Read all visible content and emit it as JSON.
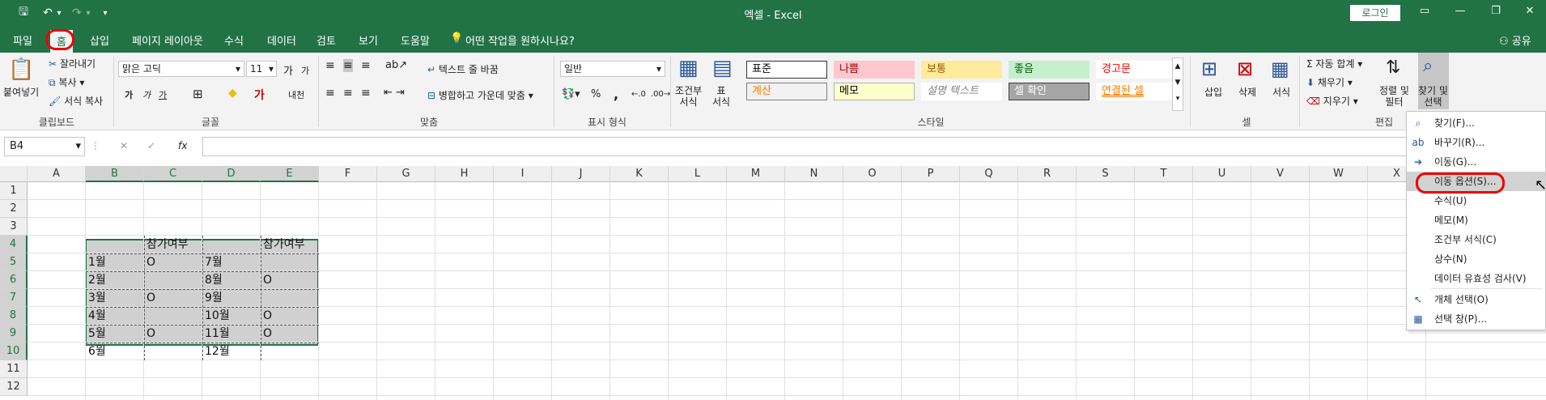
{
  "titlebar": {
    "title": "엑셀  -  Excel",
    "login": "로그인",
    "qa": {
      "save": "🖫",
      "undo": "↶",
      "undo_more": "▾",
      "redo": "↷",
      "redo_more": "▾",
      "customize": "▾"
    },
    "winctl": {
      "ribbon_opt": "▭",
      "minimize": "—",
      "restore": "❐",
      "close": "✕"
    }
  },
  "tabs": [
    "파일",
    "홈",
    "삽입",
    "페이지 레이아웃",
    "수식",
    "데이터",
    "검토",
    "보기",
    "도움말"
  ],
  "tell_me": "어떤 작업을 원하시나요?",
  "share": "공유",
  "ribbon": {
    "clipboard": {
      "paste": "붙여넣기",
      "cut": "잘라내기",
      "copy": "복사",
      "format_painter": "서식 복사",
      "group": "클립보드"
    },
    "font": {
      "font_name": "맑은 고딕",
      "font_size": "11",
      "bold": "가",
      "italic": "가",
      "underline": "가",
      "grow": "가",
      "shrink": "가",
      "group": "글꼴",
      "phonetic": "내천"
    },
    "alignment": {
      "wrap": "텍스트 줄 바꿈",
      "merge": "병합하고 가운데 맞춤",
      "group": "맞춤"
    },
    "number": {
      "format": "일반",
      "percent": "%",
      "comma": ",",
      "group": "표시 형식"
    },
    "styles": {
      "conditional": "조건부\n서식",
      "table": "표\n서식",
      "cells": [
        {
          "label": "표준",
          "bg": "#ffffff",
          "fg": "#000000",
          "border": "#333333"
        },
        {
          "label": "나쁨",
          "bg": "#ffc7ce",
          "fg": "#9c0006",
          "border": "#ffc7ce"
        },
        {
          "label": "보통",
          "bg": "#ffeb9c",
          "fg": "#9c5700",
          "border": "#ffeb9c"
        },
        {
          "label": "좋음",
          "bg": "#c6efce",
          "fg": "#006100",
          "border": "#c6efce"
        },
        {
          "label": "경고문",
          "bg": "#ffffff",
          "fg": "#ff0000",
          "border": "#ffffff"
        },
        {
          "label": "계산",
          "bg": "#f2f2f2",
          "fg": "#fa7d00",
          "border": "#7f7f7f"
        },
        {
          "label": "메모",
          "bg": "#ffffcc",
          "fg": "#000000",
          "border": "#b2b2b2"
        },
        {
          "label": "설명 텍스트",
          "bg": "#ffffff",
          "fg": "#7f7f7f",
          "border": "#ffffff"
        },
        {
          "label": "셀 확인",
          "bg": "#a5a5a5",
          "fg": "#ffffff",
          "border": "#3f3f3f"
        },
        {
          "label": "연결된 셀",
          "bg": "#ffffff",
          "fg": "#fa7d00",
          "border": "#ffffff"
        }
      ],
      "group": "스타일"
    },
    "cells": {
      "insert": "삽입",
      "delete": "삭제",
      "format": "서식",
      "group": "셀"
    },
    "editing": {
      "autosum": "자동 합계",
      "fill": "채우기",
      "clear": "지우기",
      "sort": "정렬 및\n필터",
      "find": "찾기 및\n선택",
      "group": "편집"
    }
  },
  "formula_bar": {
    "name_box": "B4",
    "fx": "fx",
    "cancel": "✕",
    "enter": "✓",
    "value": ""
  },
  "grid": {
    "columns": [
      "A",
      "B",
      "C",
      "D",
      "E",
      "F",
      "G",
      "H",
      "I",
      "J",
      "K",
      "L",
      "M",
      "N",
      "O",
      "P",
      "Q",
      "R",
      "S",
      "T",
      "U",
      "V",
      "W",
      "X"
    ],
    "selected_columns": [
      "B",
      "C",
      "D",
      "E"
    ],
    "rows": [
      "1",
      "2",
      "3",
      "4",
      "5",
      "6",
      "7",
      "8",
      "9",
      "10",
      "11",
      "12"
    ],
    "selected_rows": [
      "4",
      "5",
      "6",
      "7",
      "8",
      "9",
      "10"
    ],
    "cells": [
      {
        "col": "C",
        "row": "4",
        "value": "참가여부"
      },
      {
        "col": "E",
        "row": "4",
        "value": "참가여부"
      },
      {
        "col": "B",
        "row": "5",
        "value": "1월"
      },
      {
        "col": "C",
        "row": "5",
        "value": "O"
      },
      {
        "col": "D",
        "row": "5",
        "value": "7월"
      },
      {
        "col": "B",
        "row": "6",
        "value": "2월"
      },
      {
        "col": "D",
        "row": "6",
        "value": "8월"
      },
      {
        "col": "E",
        "row": "6",
        "value": "O"
      },
      {
        "col": "B",
        "row": "7",
        "value": "3월"
      },
      {
        "col": "C",
        "row": "7",
        "value": "O"
      },
      {
        "col": "D",
        "row": "7",
        "value": "9월"
      },
      {
        "col": "B",
        "row": "8",
        "value": "4월"
      },
      {
        "col": "D",
        "row": "8",
        "value": "10월"
      },
      {
        "col": "E",
        "row": "8",
        "value": "O"
      },
      {
        "col": "B",
        "row": "9",
        "value": "5월"
      },
      {
        "col": "C",
        "row": "9",
        "value": "O"
      },
      {
        "col": "D",
        "row": "9",
        "value": "11월"
      },
      {
        "col": "E",
        "row": "9",
        "value": "O"
      },
      {
        "col": "B",
        "row": "10",
        "value": "6월"
      },
      {
        "col": "D",
        "row": "10",
        "value": "12월"
      }
    ]
  },
  "menu": {
    "items": [
      {
        "icon": "search-icon",
        "glyph": "⌕",
        "label": "찾기(F)..."
      },
      {
        "icon": "replace-icon",
        "glyph": "ab",
        "label": "바꾸기(R)..."
      },
      {
        "icon": "goto-arrow-icon",
        "glyph": "➔",
        "label": "이동(G)..."
      },
      {
        "icon": "",
        "glyph": "",
        "label": "이동 옵션(S)...",
        "hover": true
      },
      {
        "icon": "",
        "glyph": "",
        "label": "수식(U)"
      },
      {
        "icon": "",
        "glyph": "",
        "label": "메모(M)"
      },
      {
        "icon": "",
        "glyph": "",
        "label": "조건부 서식(C)"
      },
      {
        "icon": "",
        "glyph": "",
        "label": "상수(N)"
      },
      {
        "icon": "",
        "glyph": "",
        "label": "데이터 유효성 검사(V)"
      },
      {
        "icon": "select-objects-icon",
        "glyph": "↖",
        "label": "개체 선택(O)"
      },
      {
        "icon": "selection-pane-icon",
        "glyph": "▦",
        "label": "선택 창(P)..."
      }
    ]
  },
  "colors": {
    "excel_green": "#217346",
    "annotation_red": "#e00000"
  }
}
